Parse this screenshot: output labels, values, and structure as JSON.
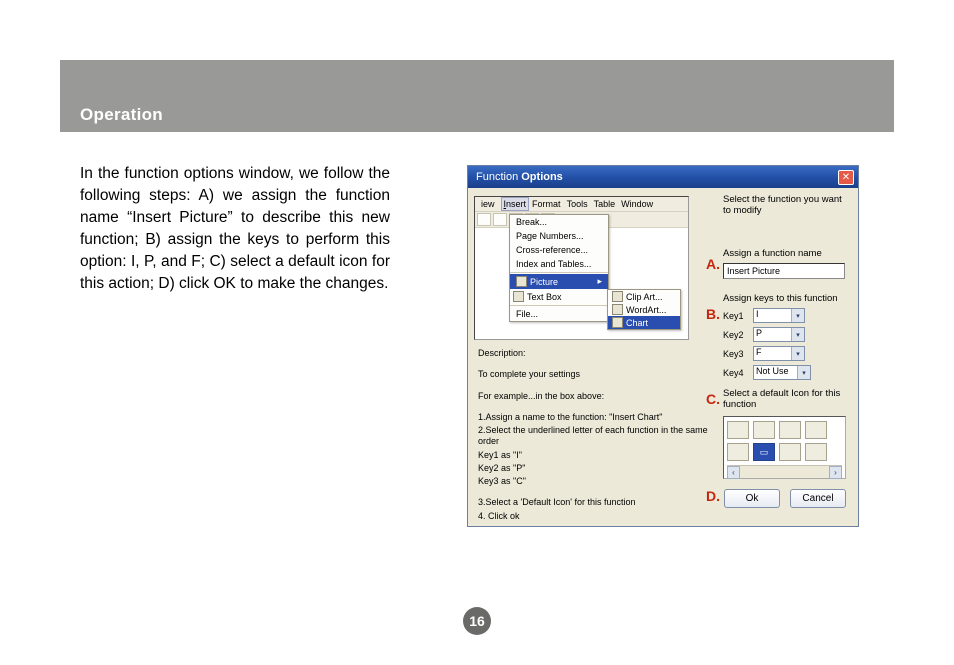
{
  "header": {
    "title": "Operation"
  },
  "body_text": "In the function options window, we follow the following steps:  A) we assign the function name “Insert Picture” to describe this new function; B) assign the keys to perform this option: I, P, and F; C) select a default icon for this action; D) click OK to make the changes.",
  "page_number": "16",
  "dialog": {
    "title_plain": "Function ",
    "title_bold": "Options",
    "close_glyph": "✕",
    "menubar": {
      "iew": "iew",
      "insert": "Insert",
      "format": "Format",
      "tools": "Tools",
      "table": "Table",
      "window": "Window"
    },
    "dropdown": {
      "break": "Break...",
      "page_numbers": "Page Numbers...",
      "cross_ref": "Cross-reference...",
      "index_tables": "Index and Tables...",
      "picture": "Picture",
      "text_box": "Text Box",
      "file": "File..."
    },
    "submenu": {
      "clipart": "Clip Art...",
      "wordart": "WordArt...",
      "chart": "Chart"
    },
    "right": {
      "top_label": "Select the function you want to modify",
      "assign_name": "Assign a function name",
      "name_value": "Insert Picture",
      "assign_keys": "Assign keys to this function",
      "key1_label": "Key1",
      "key1_val": "I",
      "key2_label": "Key2",
      "key2_val": "P",
      "key3_label": "Key3",
      "key3_val": "F",
      "key4_label": "Key4",
      "key4_val": "Not Use",
      "icon_label": "Select a default  Icon for this function",
      "ok": "Ok",
      "cancel": "Cancel"
    },
    "desc": {
      "l1": "Description:",
      "l2": "To complete your settings",
      "l3": "For example...in the box above:",
      "l4": "1.Assign a name to the function: \"Insert Chart\"",
      "l5": "2.Select the underlined letter of each function in the same order",
      "l6": "Key1 as \"I\"",
      "l7": "Key2 as \"P\"",
      "l8": "Key3 as \"C\"",
      "l9": "3.Select a 'Default Icon' for this function",
      "l10": "4. Click ok"
    }
  },
  "anno": {
    "a": "A.",
    "b": "B.",
    "c": "C.",
    "d": "D."
  }
}
